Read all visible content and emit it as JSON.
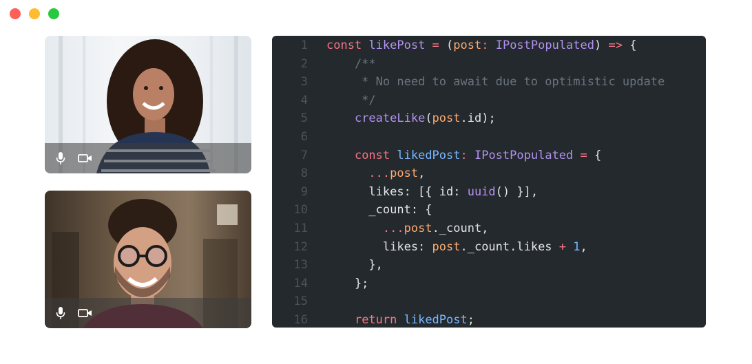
{
  "window": {
    "controls": [
      {
        "name": "close",
        "color": "#fe5f57"
      },
      {
        "name": "minimize",
        "color": "#febc2e"
      },
      {
        "name": "maximize",
        "color": "#28c840"
      }
    ]
  },
  "participants": [
    {
      "id": "participant-1",
      "controls": [
        "microphone-icon",
        "video-camera-icon"
      ]
    },
    {
      "id": "participant-2",
      "controls": [
        "microphone-icon",
        "video-camera-icon"
      ]
    }
  ],
  "code": {
    "lines": [
      {
        "n": "1",
        "tokens": [
          [
            "kw",
            "const "
          ],
          [
            "fn",
            "likePost"
          ],
          [
            "kw",
            " = "
          ],
          [
            "txt",
            "("
          ],
          [
            "param",
            "post"
          ],
          [
            "kw",
            ": "
          ],
          [
            "fn",
            "IPostPopulated"
          ],
          [
            "txt",
            ") "
          ],
          [
            "kw",
            "=>"
          ],
          [
            "txt",
            " {"
          ]
        ]
      },
      {
        "n": "2",
        "tokens": [
          [
            "cm",
            "    /**"
          ]
        ]
      },
      {
        "n": "3",
        "tokens": [
          [
            "cm",
            "     * No need to await due to optimistic update"
          ]
        ]
      },
      {
        "n": "4",
        "tokens": [
          [
            "cm",
            "     */"
          ]
        ]
      },
      {
        "n": "5",
        "tokens": [
          [
            "txt",
            "    "
          ],
          [
            "fn",
            "createLike"
          ],
          [
            "txt",
            "("
          ],
          [
            "param",
            "post"
          ],
          [
            "txt",
            ".id);"
          ]
        ]
      },
      {
        "n": "6",
        "tokens": [
          [
            "txt",
            ""
          ]
        ]
      },
      {
        "n": "7",
        "tokens": [
          [
            "txt",
            "    "
          ],
          [
            "kw",
            "const "
          ],
          [
            "var",
            "likedPost"
          ],
          [
            "kw",
            ": "
          ],
          [
            "fn",
            "IPostPopulated"
          ],
          [
            "kw",
            " = "
          ],
          [
            "txt",
            "{"
          ]
        ]
      },
      {
        "n": "8",
        "tokens": [
          [
            "txt",
            "      "
          ],
          [
            "kw",
            "..."
          ],
          [
            "param",
            "post"
          ],
          [
            "txt",
            ","
          ]
        ]
      },
      {
        "n": "9",
        "tokens": [
          [
            "txt",
            "      likes: [{ id: "
          ],
          [
            "fn",
            "uuid"
          ],
          [
            "txt",
            "() }],"
          ]
        ]
      },
      {
        "n": "10",
        "tokens": [
          [
            "txt",
            "      _count: {"
          ]
        ]
      },
      {
        "n": "11",
        "tokens": [
          [
            "txt",
            "        "
          ],
          [
            "kw",
            "..."
          ],
          [
            "param",
            "post"
          ],
          [
            "txt",
            "._count,"
          ]
        ]
      },
      {
        "n": "12",
        "tokens": [
          [
            "txt",
            "        likes: "
          ],
          [
            "param",
            "post"
          ],
          [
            "txt",
            "._count.likes "
          ],
          [
            "kw",
            "+"
          ],
          [
            "txt",
            " "
          ],
          [
            "num",
            "1"
          ],
          [
            "txt",
            ","
          ]
        ]
      },
      {
        "n": "13",
        "tokens": [
          [
            "txt",
            "      },"
          ]
        ]
      },
      {
        "n": "14",
        "tokens": [
          [
            "txt",
            "    };"
          ]
        ]
      },
      {
        "n": "15",
        "tokens": [
          [
            "txt",
            ""
          ]
        ]
      },
      {
        "n": "16",
        "tokens": [
          [
            "txt",
            "    "
          ],
          [
            "kw",
            "return "
          ],
          [
            "var",
            "likedPost"
          ],
          [
            "txt",
            ";"
          ]
        ]
      }
    ]
  }
}
